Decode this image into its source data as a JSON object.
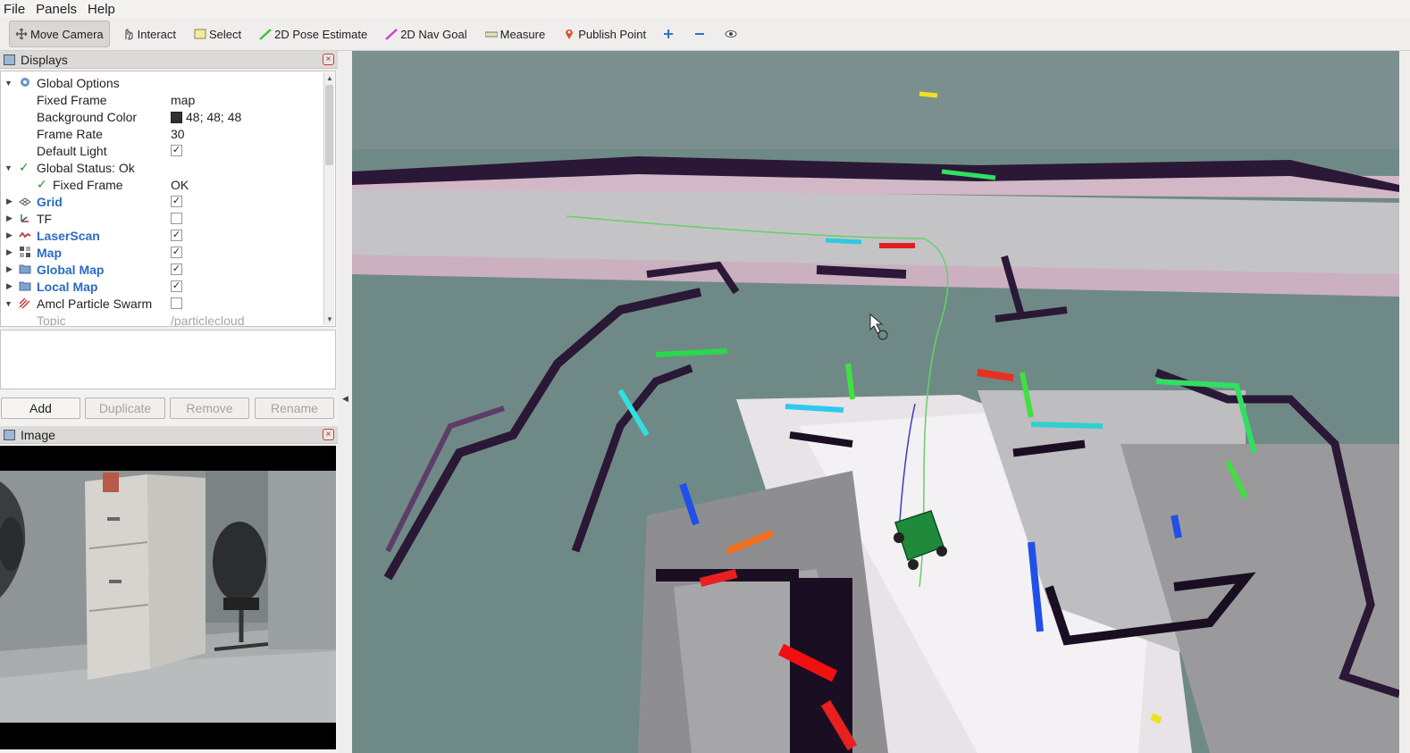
{
  "menu": [
    "File",
    "Panels",
    "Help"
  ],
  "toolbar": {
    "move_camera": "Move Camera",
    "interact": "Interact",
    "select": "Select",
    "pose_estimate": "2D Pose Estimate",
    "nav_goal": "2D Nav Goal",
    "measure": "Measure",
    "publish_point": "Publish Point"
  },
  "displays": {
    "title": "Displays",
    "rows": [
      {
        "label": "Global Options",
        "value": ""
      },
      {
        "label": "Fixed Frame",
        "value": "map"
      },
      {
        "label": "Background Color",
        "value": "48; 48; 48"
      },
      {
        "label": "Frame Rate",
        "value": "30"
      },
      {
        "label": "Default Light",
        "value": ""
      },
      {
        "label": "Global Status: Ok",
        "value": ""
      },
      {
        "label": "Fixed Frame",
        "value": "OK"
      },
      {
        "label": "Grid",
        "value": ""
      },
      {
        "label": "TF",
        "value": ""
      },
      {
        "label": "LaserScan",
        "value": ""
      },
      {
        "label": "Map",
        "value": ""
      },
      {
        "label": "Global Map",
        "value": ""
      },
      {
        "label": "Local Map",
        "value": ""
      },
      {
        "label": "Amcl Particle Swarm",
        "value": ""
      },
      {
        "label": "Topic",
        "value": "/particlecloud"
      }
    ],
    "buttons": {
      "add": "Add",
      "duplicate": "Duplicate",
      "remove": "Remove",
      "rename": "Rename"
    }
  },
  "image_panel": {
    "title": "Image"
  },
  "colors": {
    "background_color": "#303030",
    "accent_blue": "#2a6bc4"
  }
}
